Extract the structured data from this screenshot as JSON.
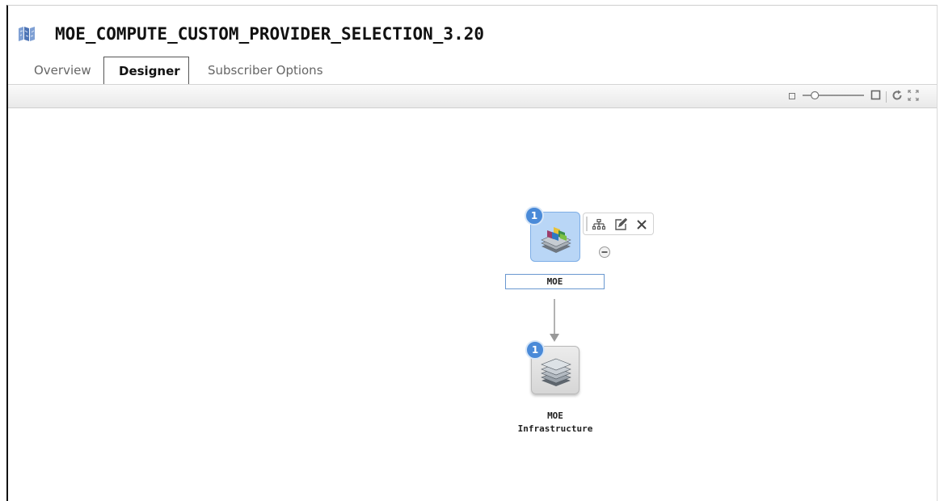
{
  "header": {
    "title": "MOE_COMPUTE_CUSTOM_PROVIDER_SELECTION_3.20",
    "icon": "map-icon"
  },
  "tabs": [
    {
      "label": "Overview",
      "active": false
    },
    {
      "label": "Designer",
      "active": true
    },
    {
      "label": "Subscriber Options",
      "active": false
    }
  ],
  "toolbar": {
    "zoom_level": 0.2,
    "icons": [
      "zoom-out-icon",
      "zoom-slider",
      "zoom-in-icon",
      "refresh-icon",
      "fullscreen-icon"
    ]
  },
  "canvas": {
    "nodes": [
      {
        "label": "MOE",
        "badge": "1",
        "selected": true,
        "icon": "colored-layers-icon"
      },
      {
        "label_line1": "MOE",
        "label_line2": "Infrastructure",
        "badge": "1",
        "selected": false,
        "icon": "gray-layers-icon"
      }
    ],
    "node_actions": [
      "topology-icon",
      "edit-icon",
      "close-icon",
      "collapse-icon"
    ]
  },
  "colors": {
    "badge": "#4a8ad8",
    "selected_node_bg": "#b9d6f6",
    "node_bg": "#e8e8e8",
    "title_icon": "#4d74b5"
  }
}
